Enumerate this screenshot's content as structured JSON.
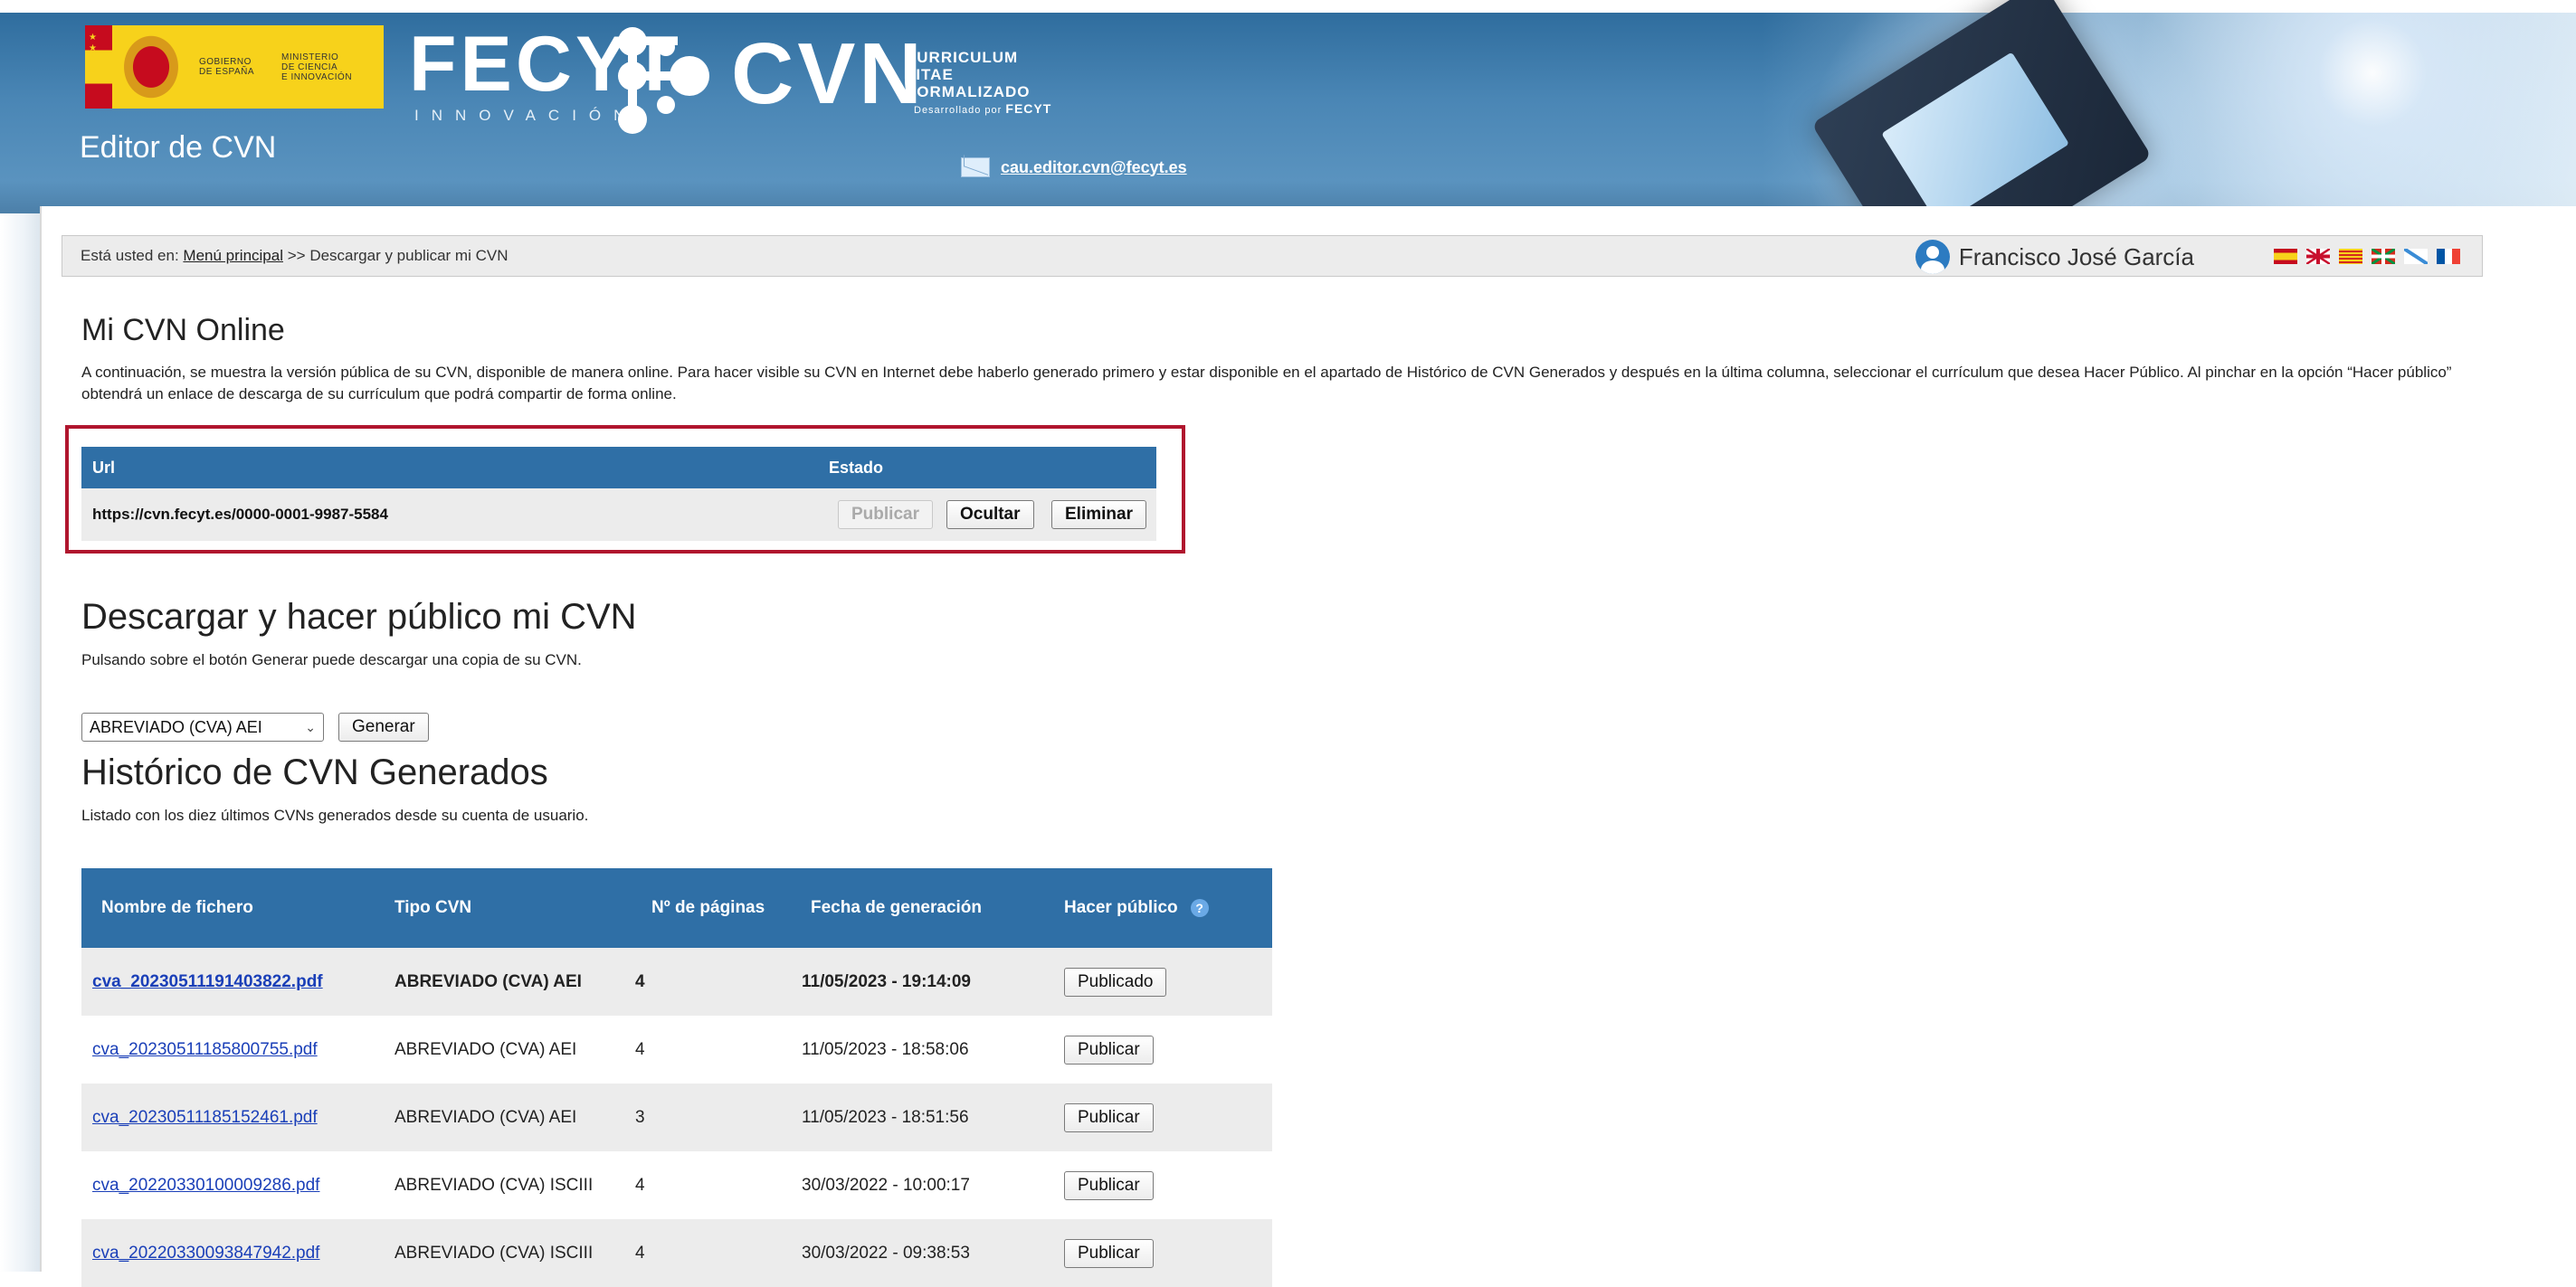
{
  "header": {
    "gov_line1": "GOBIERNO",
    "gov_line2": "DE ESPAÑA",
    "ministry_line1": "MINISTERIO",
    "ministry_line2": "DE CIENCIA",
    "ministry_line3": "E INNOVACIÓN",
    "fecyt": "FECYT",
    "fecyt_sub": "INNOVACIÓN",
    "cvn": "CVN",
    "cvn_line1": "CURRICULUM",
    "cvn_line2": "VITAE",
    "cvn_line3": "NORMALIZADO",
    "developed_by": "Desarrollado por",
    "developed_by_brand": "FECYT",
    "app_title": "Editor de CVN",
    "support_email": "cau.editor.cvn@fecyt.es"
  },
  "breadcrumb": {
    "prefix": "Está usted en:",
    "home_link": "Menú principal",
    "separator": ">>",
    "current": "Descargar y publicar mi CVN"
  },
  "user": {
    "name": "Francisco José García"
  },
  "languages": [
    "es",
    "en",
    "ca",
    "eu",
    "gl",
    "fr"
  ],
  "online": {
    "title": "Mi CVN Online",
    "description": "A continuación, se muestra la versión pública de su CVN, disponible de manera online. Para hacer visible su CVN en Internet debe haberlo generado primero y estar disponible en el apartado de Histórico de CVN Generados y después en la última columna, seleccionar el currículum que desea Hacer Público. Al pinchar en la opción “Hacer público” obtendrá un enlace de descarga de su currículum que podrá compartir de forma online.",
    "col_url": "Url",
    "col_status": "Estado",
    "url": "https://cvn.fecyt.es/0000-0001-9987-5584",
    "btn_publish": "Publicar",
    "btn_hide": "Ocultar",
    "btn_delete": "Eliminar"
  },
  "download": {
    "title": "Descargar y hacer público mi CVN",
    "description": "Pulsando sobre el botón Generar puede descargar una copia de su CVN.",
    "selected_format": "ABREVIADO (CVA) AEI",
    "btn_generate": "Generar"
  },
  "history": {
    "title": "Histórico de CVN Generados",
    "description": "Listado con los diez últimos CVNs generados desde su cuenta de usuario.",
    "columns": [
      "Nombre de fichero",
      "Tipo CVN",
      "Nº de páginas",
      "Fecha de generación",
      "Hacer público"
    ],
    "rows": [
      {
        "file": "cva_20230511191403822.pdf",
        "type": "ABREVIADO (CVA) AEI",
        "pages": "4",
        "date": "11/05/2023 - 19:14:09",
        "action": "Publicado"
      },
      {
        "file": "cva_20230511185800755.pdf",
        "type": "ABREVIADO (CVA) AEI",
        "pages": "4",
        "date": "11/05/2023 - 18:58:06",
        "action": "Publicar"
      },
      {
        "file": "cva_20230511185152461.pdf",
        "type": "ABREVIADO (CVA) AEI",
        "pages": "3",
        "date": "11/05/2023 - 18:51:56",
        "action": "Publicar"
      },
      {
        "file": "cva_20220330100009286.pdf",
        "type": "ABREVIADO (CVA) ISCIII",
        "pages": "4",
        "date": "30/03/2022 - 10:00:17",
        "action": "Publicar"
      },
      {
        "file": "cva_20220330093847942.pdf",
        "type": "ABREVIADO (CVA) ISCIII",
        "pages": "4",
        "date": "30/03/2022 - 09:38:53",
        "action": "Publicar"
      }
    ]
  },
  "colors": {
    "header_blue": "#2f6d9e",
    "table_head": "#2f6fa6",
    "highlight_red": "#b0162e",
    "link_blue": "#1a3fb8"
  }
}
